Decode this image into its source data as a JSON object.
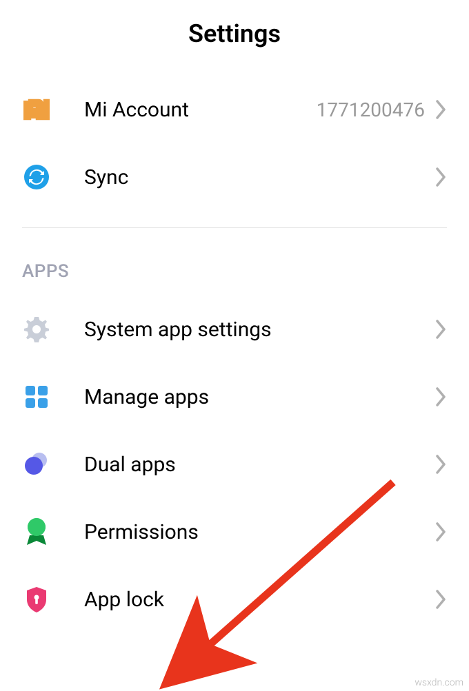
{
  "header": {
    "title": "Settings"
  },
  "account_section": {
    "items": [
      {
        "label": "Mi Account",
        "value": "1771200476"
      },
      {
        "label": "Sync",
        "value": ""
      }
    ]
  },
  "apps_section": {
    "header": "APPS",
    "items": [
      {
        "label": "System app settings"
      },
      {
        "label": "Manage apps"
      },
      {
        "label": "Dual apps"
      },
      {
        "label": "Permissions"
      },
      {
        "label": "App lock"
      }
    ]
  },
  "watermark": "wsxdn.com"
}
